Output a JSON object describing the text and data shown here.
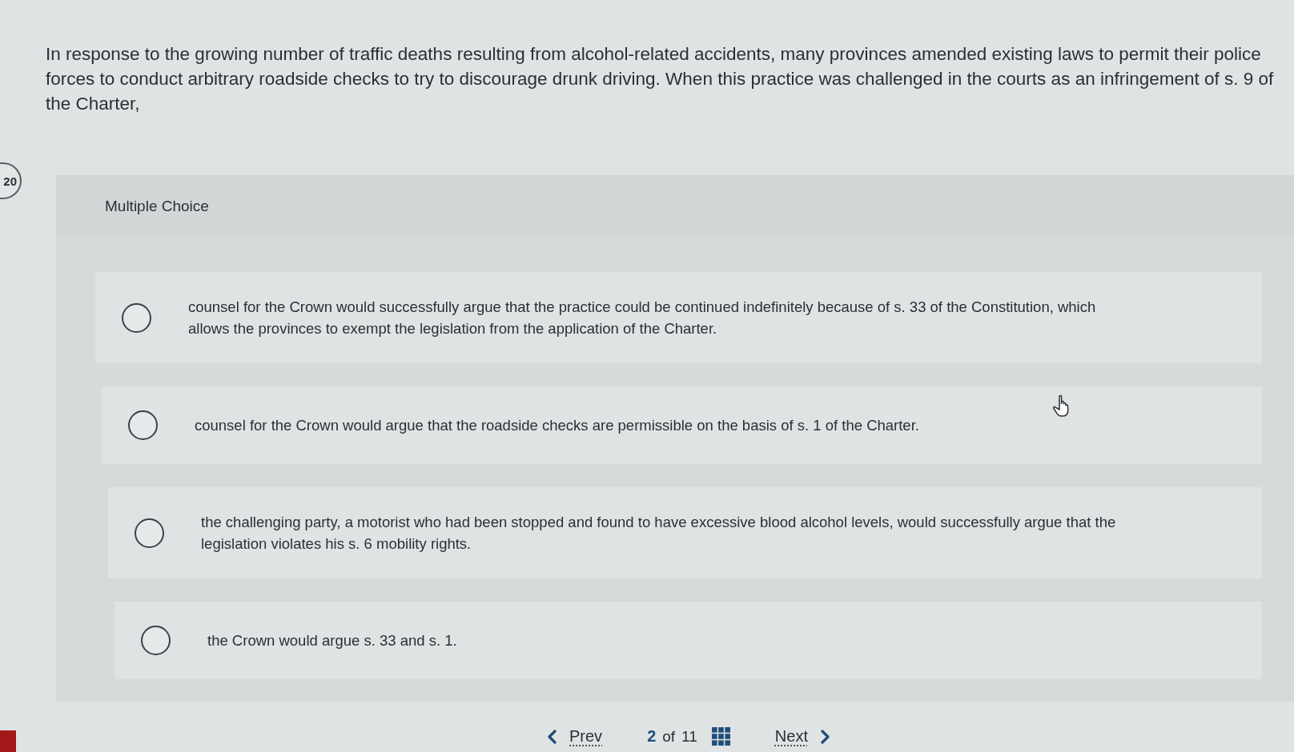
{
  "question": {
    "number": "20",
    "text": "In response to the growing number of traffic deaths resulting from alcohol-related accidents, many provinces amended existing laws to permit their police forces to conduct arbitrary roadside checks to try to discourage drunk driving. When this practice was challenged in the courts as an infringement of s. 9 of the Charter,"
  },
  "panel": {
    "heading": "Multiple Choice"
  },
  "options": [
    {
      "text": "counsel for the Crown would successfully argue that the practice could be continued indefinitely because of s. 33 of the Constitution, which allows the provinces to exempt the legislation from the application of the Charter.",
      "selected": false
    },
    {
      "text": "counsel for the Crown would argue that the roadside checks are permissible on the basis of s. 1 of the Charter.",
      "selected": false
    },
    {
      "text": "the challenging party, a motorist who had been stopped and found to have excessive blood alcohol levels, would successfully argue that the legislation violates his s. 6 mobility rights.",
      "selected": false
    },
    {
      "text": "the Crown would argue s. 33 and s. 1.",
      "selected": false
    }
  ],
  "nav": {
    "prev": "Prev",
    "current": "2",
    "of": "of",
    "total": "11",
    "next": "Next"
  }
}
